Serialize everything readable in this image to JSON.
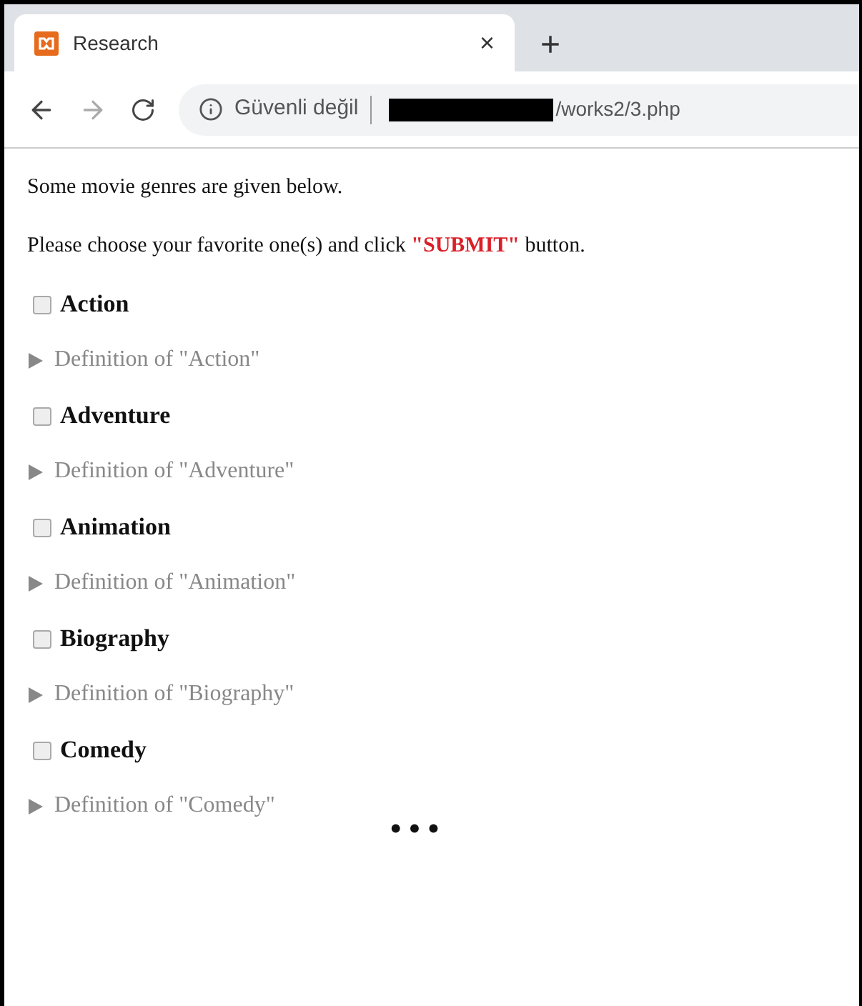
{
  "browser": {
    "tab": {
      "title": "Research",
      "close": "×"
    },
    "new_tab": "+",
    "address": {
      "security": "Güvenli değil",
      "url": "/works2/3.php"
    }
  },
  "intro": [
    "Some movie genres are given below.",
    "Please choose your favorite one(s) and click **\"SUBMIT\"** button."
  ],
  "genres": [
    {
      "label": "Action",
      "checked": false,
      "definition": "Definition of \"Action\"",
      "expanded": false
    },
    {
      "label": "Adventure",
      "checked": false,
      "definition": "Definition of \"Adventure\"",
      "expanded": false
    },
    {
      "label": "Animation",
      "checked": false,
      "definition": "Definition of \"Animation\"",
      "expanded": false
    },
    {
      "label": "Biography",
      "checked": false,
      "definition": "Definition of \"Biography\"",
      "expanded": false
    },
    {
      "label": "Comedy",
      "checked": false,
      "definition": "Definition of \"Comedy\"",
      "expanded": false
    }
  ],
  "more": "• • •"
}
